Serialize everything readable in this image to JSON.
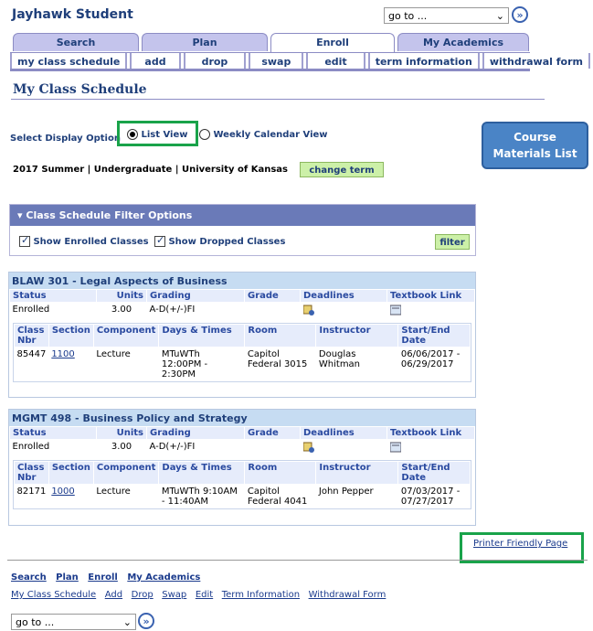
{
  "app_title": "Jayhawk Student",
  "goto_label": "go to ...",
  "tabs": [
    "Search",
    "Plan",
    "Enroll",
    "My Academics"
  ],
  "subnav": [
    "my class schedule",
    "add",
    "drop",
    "swap",
    "edit",
    "term information",
    "withdrawal form"
  ],
  "page_title": "My Class Schedule",
  "display": {
    "label": "Select Display Option",
    "list_view": "List View",
    "calendar_view": "Weekly Calendar View"
  },
  "course_materials": {
    "line1": "Course",
    "line2": "Materials List"
  },
  "term": "2017 Summer | Undergraduate | University of Kansas",
  "change_term": "change term",
  "filter": {
    "title": "Class Schedule Filter Options",
    "show_enrolled": "Show Enrolled Classes",
    "show_dropped": "Show Dropped Classes",
    "button": "filter"
  },
  "headers": {
    "status": "Status",
    "units": "Units",
    "grading": "Grading",
    "grade": "Grade",
    "deadlines": "Deadlines",
    "textbook": "Textbook Link",
    "class_nbr": "Class Nbr",
    "section": "Section",
    "component": "Component",
    "days_times": "Days & Times",
    "room": "Room",
    "instructor": "Instructor",
    "start_end": "Start/End Date"
  },
  "courses": [
    {
      "title": "BLAW 301 - Legal Aspects of Business",
      "status": "Enrolled",
      "units": "3.00",
      "grading": "A-D(+/-)FI",
      "class_nbr": "85447",
      "section": "1100",
      "component": "Lecture",
      "days_times": "MTuWTh 12:00PM - 2:30PM",
      "room": "Capitol Federal 3015",
      "instructor": "Douglas Whitman",
      "dates": "06/06/2017 - 06/29/2017"
    },
    {
      "title": "MGMT 498 - Business Policy and Strategy",
      "status": "Enrolled",
      "units": "3.00",
      "grading": "A-D(+/-)FI",
      "class_nbr": "82171",
      "section": "1000",
      "component": "Lecture",
      "days_times": "MTuWTh 9:10AM - 11:40AM",
      "room": "Capitol Federal 4041",
      "instructor": "John Pepper",
      "dates": "07/03/2017 - 07/27/2017"
    }
  ],
  "printer_friendly": "Printer Friendly Page",
  "footer_links": [
    "Search",
    "Plan",
    "Enroll",
    "My Academics"
  ],
  "footer_sub": [
    "My Class Schedule",
    "Add",
    "Drop",
    "Swap",
    "Edit",
    "Term Information",
    "Withdrawal Form"
  ],
  "colors": {
    "accent": "#19a34a",
    "header": "#6a7ab8",
    "brand": "#1f3f7a"
  }
}
